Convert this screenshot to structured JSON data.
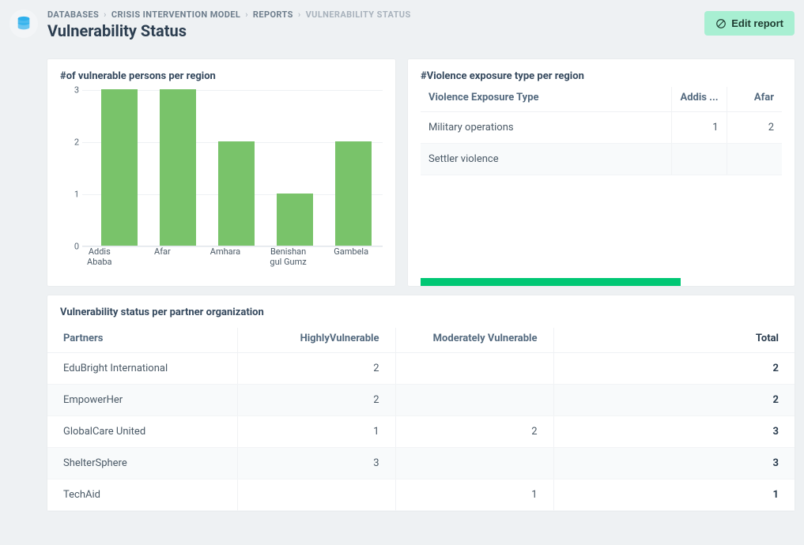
{
  "breadcrumbs": {
    "items": [
      {
        "label": "DATABASES"
      },
      {
        "label": "CRISIS INTERVENTION MODEL"
      },
      {
        "label": "REPORTS"
      }
    ],
    "current": "VULNERABILITY STATUS"
  },
  "page_title": "Vulnerability Status",
  "edit_button_label": "Edit report",
  "card_chart": {
    "title": "#of vulnerable persons per region"
  },
  "card_violence": {
    "title": "#Violence exposure type per region",
    "columns": [
      "Violence Exposure Type",
      "Addis ...",
      "Afar"
    ],
    "rows": [
      {
        "label": "Military operations",
        "addis": "1",
        "afar": "2"
      },
      {
        "label": "Settler violence",
        "addis": "",
        "afar": ""
      }
    ]
  },
  "card_partners": {
    "title": "Vulnerability status per partner organization",
    "columns": [
      "Partners",
      "HighlyVulnerable",
      "Moderately Vulnerable",
      "Total"
    ],
    "rows": [
      {
        "partner": "EduBright International",
        "high": "2",
        "mod": "",
        "total": "2"
      },
      {
        "partner": "EmpowerHer",
        "high": "2",
        "mod": "",
        "total": "2"
      },
      {
        "partner": "GlobalCare United",
        "high": "1",
        "mod": "2",
        "total": "3"
      },
      {
        "partner": "ShelterSphere",
        "high": "3",
        "mod": "",
        "total": "3"
      },
      {
        "partner": "TechAid",
        "high": "",
        "mod": "1",
        "total": "1"
      }
    ]
  },
  "chart_data": {
    "type": "bar",
    "title": "#of vulnerable persons per region",
    "categories": [
      "Addis Ababa",
      "Afar",
      "Amhara",
      "Benishan gul Gumz",
      "Gambela"
    ],
    "values": [
      3,
      3,
      2,
      1,
      2
    ],
    "ylim": [
      0,
      3
    ],
    "yticks": [
      0,
      1,
      2,
      3
    ],
    "xlabel": "",
    "ylabel": ""
  }
}
